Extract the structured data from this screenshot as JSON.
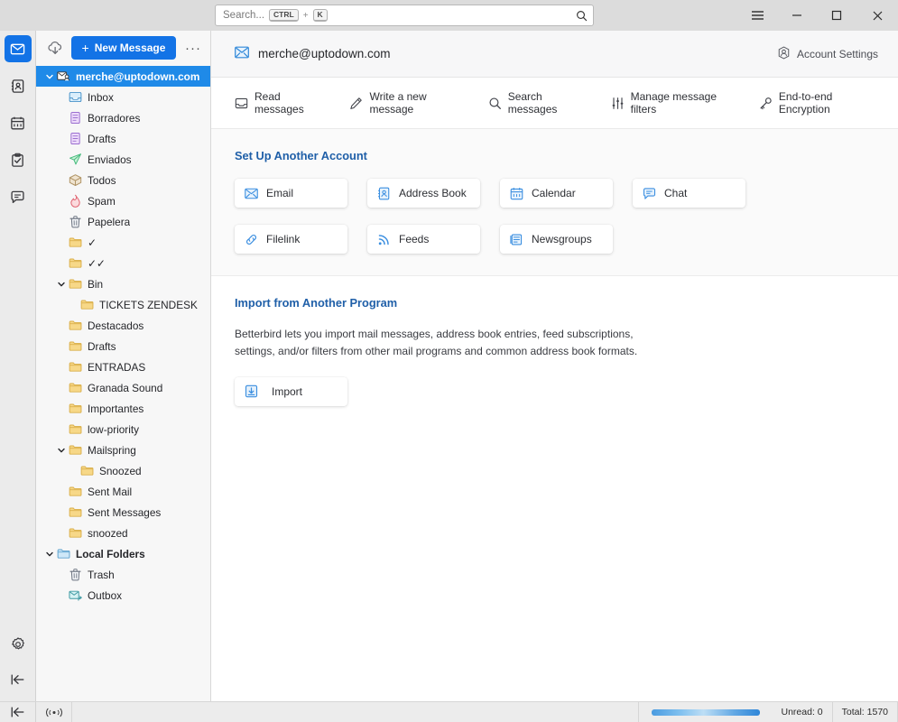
{
  "titlebar": {
    "search": {
      "placeholder": "Search...",
      "key1": "CTRL",
      "plus": "+",
      "key2": "K"
    },
    "menu_label": "☰",
    "minimize_label": "–",
    "maximize_label": "□",
    "close_label": "✕"
  },
  "rail": {
    "items": [
      {
        "name": "mail",
        "title": "Mail",
        "active": true
      },
      {
        "name": "address-book",
        "title": "Address Book",
        "active": false
      },
      {
        "name": "calendar",
        "title": "Calendar",
        "active": false
      },
      {
        "name": "tasks",
        "title": "Tasks",
        "active": false
      },
      {
        "name": "chat",
        "title": "Chat",
        "active": false
      }
    ],
    "settings_title": "Settings",
    "collapse_title": "Collapse"
  },
  "folder_pane": {
    "get_messages_title": "Get Messages",
    "new_message_label": "New Message",
    "new_message_plus": "+",
    "more_label": "···",
    "tree": [
      {
        "label": "merche@uptodown.com",
        "icon": "account",
        "indent": 0,
        "twisty": "down",
        "selected": true,
        "bold": true
      },
      {
        "label": "Inbox",
        "icon": "inbox",
        "indent": 1
      },
      {
        "label": "Borradores",
        "icon": "drafts",
        "indent": 1
      },
      {
        "label": "Drafts",
        "icon": "drafts",
        "indent": 1
      },
      {
        "label": "Enviados",
        "icon": "sent",
        "indent": 1
      },
      {
        "label": "Todos",
        "icon": "archive",
        "indent": 1
      },
      {
        "label": "Spam",
        "icon": "spam",
        "indent": 1
      },
      {
        "label": "Papelera",
        "icon": "trash",
        "indent": 1
      },
      {
        "label": "✓",
        "icon": "folder",
        "indent": 1
      },
      {
        "label": "✓✓",
        "icon": "folder",
        "indent": 1
      },
      {
        "label": "Bin",
        "icon": "folder",
        "indent": 1,
        "twisty": "down"
      },
      {
        "label": "TICKETS ZENDESK",
        "icon": "folder",
        "indent": 2
      },
      {
        "label": "Destacados",
        "icon": "folder",
        "indent": 1
      },
      {
        "label": "Drafts",
        "icon": "folder",
        "indent": 1
      },
      {
        "label": "ENTRADAS",
        "icon": "folder",
        "indent": 1
      },
      {
        "label": "Granada Sound",
        "icon": "folder",
        "indent": 1
      },
      {
        "label": "Importantes",
        "icon": "folder",
        "indent": 1
      },
      {
        "label": "low-priority",
        "icon": "folder",
        "indent": 1
      },
      {
        "label": "Mailspring",
        "icon": "folder",
        "indent": 1,
        "twisty": "down"
      },
      {
        "label": "Snoozed",
        "icon": "folder",
        "indent": 2
      },
      {
        "label": "Sent Mail",
        "icon": "folder",
        "indent": 1
      },
      {
        "label": "Sent Messages",
        "icon": "folder",
        "indent": 1
      },
      {
        "label": "snoozed",
        "icon": "folder",
        "indent": 1
      },
      {
        "label": "Local Folders",
        "icon": "local-folder",
        "indent": 0,
        "twisty": "down",
        "bold": true
      },
      {
        "label": "Trash",
        "icon": "trash",
        "indent": 1
      },
      {
        "label": "Outbox",
        "icon": "outbox",
        "indent": 1
      }
    ]
  },
  "content": {
    "account_email": "merche@uptodown.com",
    "account_settings_label": "Account Settings",
    "quick_actions": [
      {
        "label": "Read messages",
        "icon": "read-messages-icon"
      },
      {
        "label": "Write a new message",
        "icon": "write-message-icon"
      },
      {
        "label": "Search messages",
        "icon": "search-messages-icon"
      },
      {
        "label": "Manage message filters",
        "icon": "message-filters-icon"
      },
      {
        "label": "End-to-end Encryption",
        "icon": "encryption-key-icon"
      }
    ],
    "setup_section": {
      "title": "Set Up Another Account",
      "cards": [
        {
          "label": "Email",
          "icon": "email-icon"
        },
        {
          "label": "Address Book",
          "icon": "address-book-icon"
        },
        {
          "label": "Calendar",
          "icon": "calendar-icon"
        },
        {
          "label": "Chat",
          "icon": "chat-icon"
        },
        {
          "label": "Filelink",
          "icon": "filelink-icon"
        },
        {
          "label": "Feeds",
          "icon": "feeds-icon"
        },
        {
          "label": "Newsgroups",
          "icon": "newsgroups-icon"
        }
      ]
    },
    "import_section": {
      "title": "Import from Another Program",
      "description": "Betterbird lets you import mail messages, address book entries, feed subscriptions, settings, and/or filters from other mail programs and common address book formats.",
      "button_label": "Import"
    }
  },
  "statusbar": {
    "online_title": "Online",
    "unread": "Unread: 0",
    "total": "Total: 1570"
  },
  "colors": {
    "accent_blue": "#1373e6",
    "selection_blue": "#1f8ae8",
    "section_title": "#1f5fa8",
    "folder_yellow": "#f5d77f",
    "card_icon_blue": "#3a8ee0"
  }
}
